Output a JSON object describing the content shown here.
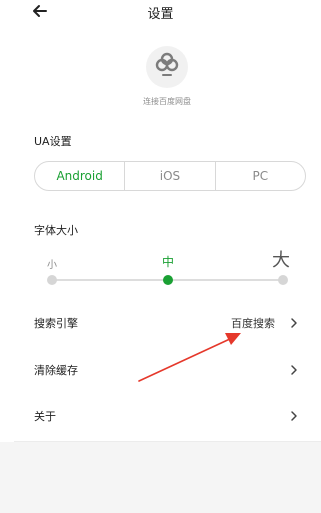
{
  "header": {
    "title": "设置",
    "back_icon": "arrow-left-icon"
  },
  "cloud": {
    "icon": "baidu-netdisk-cloud-icon",
    "label": "连接百度网盘"
  },
  "ua": {
    "title": "UA设置",
    "options": [
      "Android",
      "iOS",
      "PC"
    ],
    "selected": "Android"
  },
  "font_size": {
    "title": "字体大小",
    "labels": [
      "小",
      "中",
      "大"
    ],
    "selected": "中"
  },
  "rows": [
    {
      "label": "搜索引擎",
      "value": "百度搜索"
    },
    {
      "label": "清除缓存",
      "value": ""
    },
    {
      "label": "关于",
      "value": ""
    }
  ],
  "colors": {
    "accent": "#1aa033",
    "annotation": "#e5382b",
    "bottom_bg": "#f5f5f5"
  }
}
